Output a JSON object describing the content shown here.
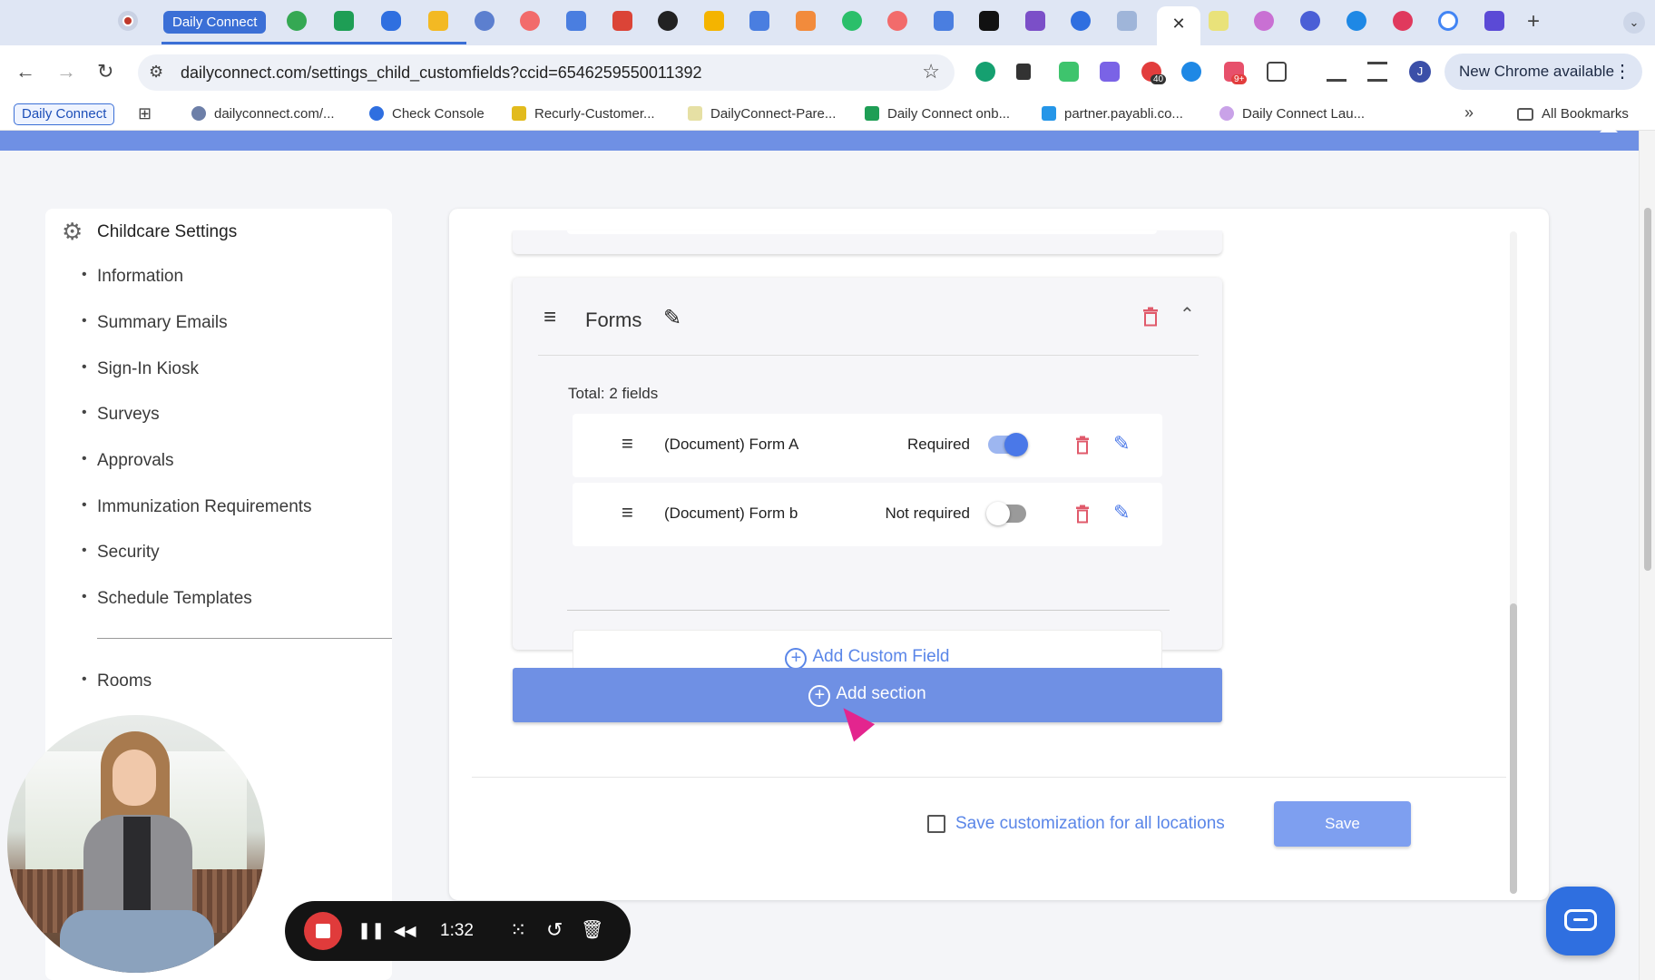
{
  "browser": {
    "active_tab_label": "Daily Connect",
    "active_tab_close": "✕",
    "new_tab": "+",
    "tab_list": "⌄",
    "nav": {
      "back": "←",
      "forward": "→",
      "reload": "↻"
    },
    "url": "dailyconnect.com/settings_child_customfields?ccid=6546259550011392",
    "site_info_icon": "⚙",
    "bookmark_star": "☆",
    "extension_badges": [
      "40",
      "9+"
    ],
    "profile_initial": "J",
    "update_chip": "New Chrome available",
    "menu": "⋮"
  },
  "bookmarks": {
    "pill": "Daily Connect",
    "apps_icon": "⊞",
    "items": [
      "dailyconnect.com/...",
      "Check Console",
      "Recurly-Customer...",
      "DailyConnect-Pare...",
      "Daily Connect onb...",
      "partner.payabli.co...",
      "Daily Connect Lau..."
    ],
    "more": "»",
    "all_bookmarks": "All Bookmarks"
  },
  "sidebar": {
    "gear_icon": "⚙",
    "title": "Childcare Settings",
    "items": [
      "Information",
      "Summary Emails",
      "Sign-In Kiosk",
      "Surveys",
      "Approvals",
      "Immunization Requirements",
      "Security",
      "Schedule Templates"
    ],
    "items_after_divider": [
      "Rooms"
    ]
  },
  "section": {
    "drag_icon": "≡",
    "title": "Forms",
    "edit_icon": "✎",
    "collapse_icon": "⌃",
    "total": "Total: 2 fields",
    "fields": [
      {
        "name": "(Document) Form A",
        "status": "Required",
        "required": true
      },
      {
        "name": "(Document) Form b",
        "status": "Not required",
        "required": false
      }
    ],
    "add_field": "Add Custom Field"
  },
  "add_section": "Add section",
  "footer": {
    "save_all_label": "Save customization for all locations",
    "save_all_checked": false,
    "save": "Save"
  },
  "recorder": {
    "time": "1:32",
    "pause": "❚❚",
    "rewind": "◀◀",
    "grid": "⁙",
    "restart": "↺",
    "delete": "🗑"
  },
  "colors": {
    "accent": "#6f90e4",
    "link_blue": "#5a86e8",
    "delete_red": "#e05a6b",
    "recorder_red": "#e03b3b",
    "chat_blue": "#2f6fe0"
  }
}
